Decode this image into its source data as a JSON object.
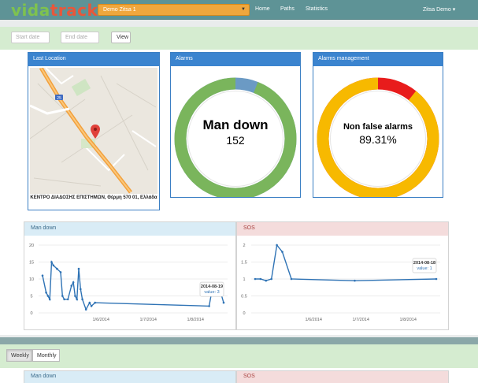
{
  "app": {
    "logo_part1": "vida",
    "logo_part2": "track",
    "zone_select": "Demo Zitsa 1",
    "nav": [
      "Home",
      "Paths",
      "Statistics"
    ],
    "user_menu": "Zitsa Demo ▾"
  },
  "filters": {
    "start_placeholder": "Start date",
    "end_placeholder": "End date",
    "view_label": "View"
  },
  "last_location": {
    "title": "Last Location",
    "address": "ΚΕΝΤΡΟ ΔΙΑΔΟΣΗΣ ΕΠΙΣΤΗΜΩΝ, Θέρμη 570 01, Ελλάδα",
    "road_badge": "25"
  },
  "alarms": {
    "title": "Alarms",
    "label": "Man down",
    "value": "152",
    "fraction": 0.94,
    "color_main": "#7ab55c",
    "color_rest": "#6b9ac4"
  },
  "alarm_management": {
    "title": "Alarms management",
    "label": "Non false alarms",
    "value": "89.31%",
    "fraction": 0.8931,
    "color_main": "#f7b900",
    "color_rest": "#e81c1c"
  },
  "charts": [
    {
      "title": "Man down",
      "head_color": "blue",
      "chart_data": {
        "type": "line",
        "yticks": [
          "20",
          "15",
          "10",
          "5",
          "0"
        ],
        "xticks": [
          "1/6/2014",
          "1/7/2014",
          "1/8/2014"
        ],
        "ylim": [
          0,
          20
        ],
        "points": [
          [
            0.0,
            11
          ],
          [
            0.02,
            6
          ],
          [
            0.03,
            5
          ],
          [
            0.04,
            4
          ],
          [
            0.05,
            15
          ],
          [
            0.06,
            14
          ],
          [
            0.08,
            13
          ],
          [
            0.1,
            12
          ],
          [
            0.11,
            5
          ],
          [
            0.12,
            4
          ],
          [
            0.14,
            4
          ],
          [
            0.16,
            8
          ],
          [
            0.17,
            9
          ],
          [
            0.18,
            5
          ],
          [
            0.19,
            4
          ],
          [
            0.2,
            13
          ],
          [
            0.21,
            7
          ],
          [
            0.22,
            4
          ],
          [
            0.24,
            1
          ],
          [
            0.26,
            3
          ],
          [
            0.27,
            2
          ],
          [
            0.29,
            3
          ],
          [
            0.92,
            2
          ],
          [
            0.94,
            8
          ],
          [
            0.97,
            8.5
          ],
          [
            1.0,
            3
          ]
        ],
        "tooltip_date": "2014-08-19",
        "tooltip_value": "value: 3"
      }
    },
    {
      "title": "SOS",
      "head_color": "red",
      "chart_data": {
        "type": "line",
        "yticks": [
          "2",
          "1.5",
          "1",
          "0.5",
          "0"
        ],
        "xticks": [
          "1/6/2014",
          "1/7/2014",
          "1/8/2014"
        ],
        "ylim": [
          0,
          2
        ],
        "points": [
          [
            0.0,
            1
          ],
          [
            0.03,
            1
          ],
          [
            0.06,
            0.95
          ],
          [
            0.09,
            1
          ],
          [
            0.12,
            2
          ],
          [
            0.15,
            1.8
          ],
          [
            0.2,
            1
          ],
          [
            0.55,
            0.95
          ],
          [
            1.0,
            1
          ]
        ],
        "tooltip_date": "2014-08-18",
        "tooltip_value": "value: 1"
      }
    }
  ],
  "bottom": {
    "weekly": "Weekly",
    "monthly": "Monthly",
    "chart1_title": "Man down",
    "chart2_title": "SOS"
  }
}
